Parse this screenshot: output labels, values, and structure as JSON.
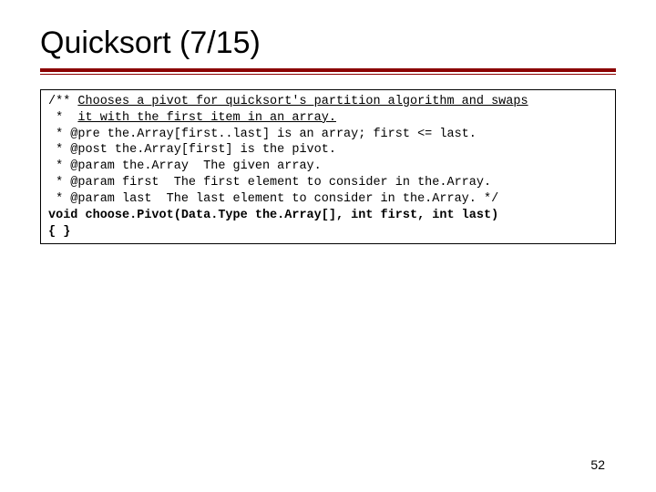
{
  "title": "Quicksort (7/15)",
  "code": {
    "l1a": "/** ",
    "l1b": "Chooses a pivot for quicksort's partition algorithm and swaps",
    "l2a": " *  ",
    "l2b": "it with the first item in an array.",
    "l3": " * @pre the.Array[first..last] is an array; first <= last.",
    "l4": " * @post the.Array[first] is the pivot.",
    "l5": " * @param the.Array  The given array.",
    "l6": " * @param first  The first element to consider in the.Array.",
    "l7": " * @param last  The last element to consider in the.Array. */",
    "l8": "void choose.Pivot(Data.Type the.Array[], int first, int last)",
    "l9": "{ }"
  },
  "page_number": "52"
}
